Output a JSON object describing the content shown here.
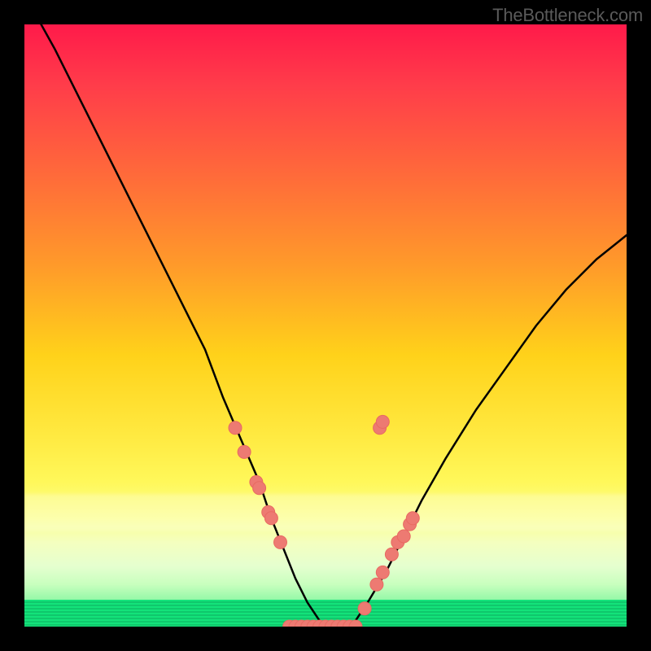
{
  "watermark": "TheBottleneck.com",
  "colors": {
    "curve": "#000000",
    "marker_fill": "#ed7a72",
    "marker_stroke": "#e86a62",
    "frame": "#000000",
    "gradient_top": "#ff1a4a",
    "gradient_bottom": "#15e07a"
  },
  "chart_data": {
    "type": "line",
    "title": "",
    "xlabel": "",
    "ylabel": "",
    "xlim": [
      0,
      100
    ],
    "ylim": [
      0,
      100
    ],
    "grid": false,
    "legend": false,
    "series": [
      {
        "name": "bottleneck-curve",
        "x": [
          0,
          5,
          10,
          15,
          20,
          25,
          30,
          33,
          36,
          39,
          41,
          43,
          45,
          47,
          49,
          51,
          53,
          55,
          57,
          60,
          63,
          66,
          70,
          75,
          80,
          85,
          90,
          95,
          100
        ],
        "values": [
          105,
          96,
          86,
          76,
          66,
          56,
          46,
          38,
          31,
          24,
          18,
          13,
          8,
          4,
          1,
          0,
          0,
          1,
          4,
          9,
          15,
          21,
          28,
          36,
          43,
          50,
          56,
          61,
          65
        ]
      }
    ],
    "left_markers": [
      {
        "x": 35.0,
        "y": 33
      },
      {
        "x": 36.5,
        "y": 29
      },
      {
        "x": 38.5,
        "y": 24
      },
      {
        "x": 39.0,
        "y": 23
      },
      {
        "x": 40.5,
        "y": 19
      },
      {
        "x": 41.0,
        "y": 18
      },
      {
        "x": 42.5,
        "y": 14
      }
    ],
    "right_markers": [
      {
        "x": 56.5,
        "y": 3
      },
      {
        "x": 58.5,
        "y": 7
      },
      {
        "x": 59.5,
        "y": 9
      },
      {
        "x": 61.0,
        "y": 12
      },
      {
        "x": 62.0,
        "y": 14
      },
      {
        "x": 63.0,
        "y": 15
      },
      {
        "x": 64.0,
        "y": 17
      },
      {
        "x": 64.5,
        "y": 18
      },
      {
        "x": 59.0,
        "y": 33
      },
      {
        "x": 59.5,
        "y": 34
      }
    ],
    "bottom_cluster": {
      "x_start": 44,
      "x_end": 55,
      "y": 0,
      "count": 12
    }
  }
}
